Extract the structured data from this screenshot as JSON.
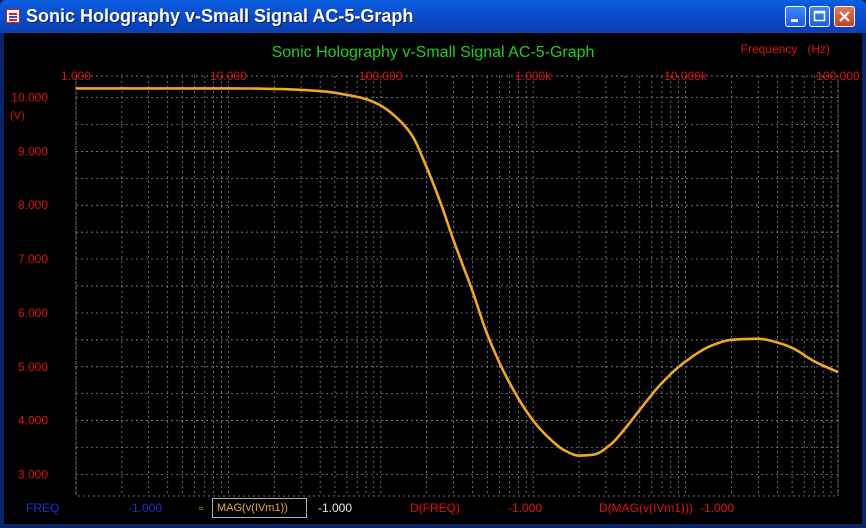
{
  "window": {
    "title": "Sonic Holography v-Small Signal AC-5-Graph"
  },
  "colors": {
    "titlebar": "#0b4fd0",
    "plot_bg": "#000000",
    "grid": "#9a9a9a",
    "trace": "#f0a824",
    "tick_red": "#e01010",
    "title_green": "#22cc22",
    "freq_blue": "#1c2fd8"
  },
  "chart_data": {
    "type": "line",
    "title": "Sonic Holography v-Small Signal AC-5-Graph",
    "xlabel": "Frequency   (Hz)",
    "ylabel": "(V)",
    "x_scale": "log",
    "xlim": [
      1,
      100000
    ],
    "ylim": [
      2.6,
      10.4
    ],
    "x_tick_labels": [
      "1.000",
      "10.000",
      "100.000",
      "1.000k",
      "10.000k",
      "100.000"
    ],
    "y_tick_labels": [
      "10.000",
      "9.000",
      "8.000",
      "7.000",
      "6.000",
      "5.000",
      "4.000",
      "3.000"
    ],
    "y_tick_values": [
      10,
      9,
      8,
      7,
      6,
      5,
      4,
      3
    ],
    "grid": true,
    "series": [
      {
        "name": "MAG(v(IVm1))",
        "x": [
          1,
          3,
          10,
          20,
          40,
          60,
          80,
          100,
          130,
          160,
          200,
          250,
          300,
          400,
          500,
          700,
          1000,
          1300,
          1600,
          2000,
          2500,
          3200,
          4000,
          5000,
          7000,
          10000,
          15000,
          20000,
          30000,
          40000,
          50000,
          70000,
          100000
        ],
        "y": [
          10.17,
          10.17,
          10.17,
          10.16,
          10.12,
          10.05,
          9.97,
          9.85,
          9.6,
          9.3,
          8.7,
          8.0,
          7.35,
          6.4,
          5.6,
          4.7,
          4.0,
          3.65,
          3.45,
          3.35,
          3.37,
          3.55,
          3.85,
          4.2,
          4.7,
          5.1,
          5.4,
          5.5,
          5.52,
          5.45,
          5.35,
          5.1,
          4.9
        ]
      }
    ]
  },
  "status_bar": {
    "freq_label": "FREQ",
    "freq_value": "-1.000",
    "series_label": "MAG(v(IVm1))",
    "series_value": "-1.000",
    "dfreq_label": "D(FREQ)",
    "dfreq_value": "-1.000",
    "dmag_label": "D(MAG(v(IVm1)))",
    "dmag_value": "-1.000"
  }
}
